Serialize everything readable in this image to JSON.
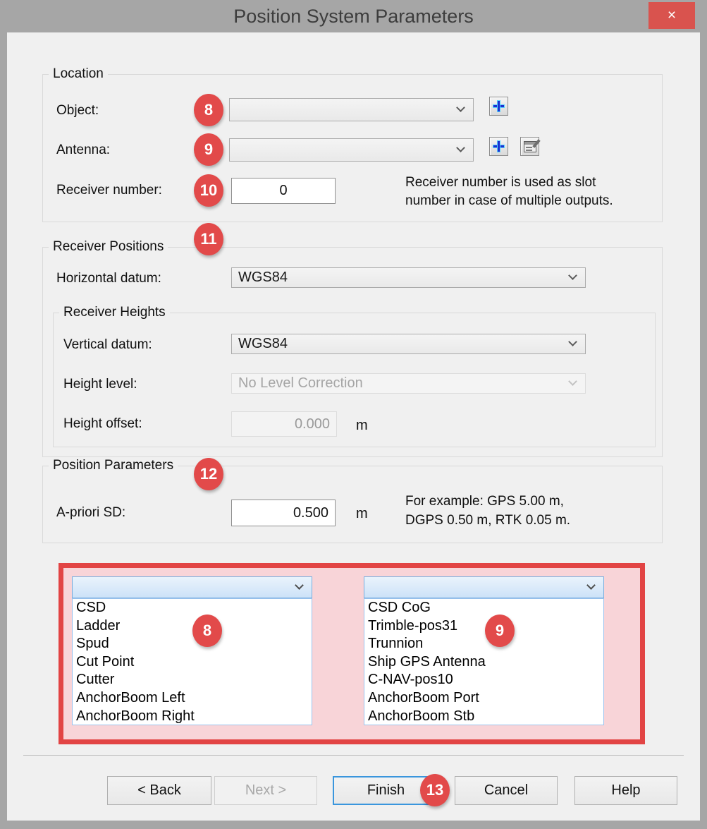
{
  "window": {
    "title": "Position System Parameters",
    "close_glyph": "×"
  },
  "location": {
    "legend": "Location",
    "object_label": "Object:",
    "antenna_label": "Antenna:",
    "receiver_number_label": "Receiver number:",
    "receiver_number_value": "0",
    "hint_line1": "Receiver number is used as slot",
    "hint_line2": "number in case of multiple outputs."
  },
  "receiver_positions": {
    "legend": "Receiver Positions",
    "horizontal_datum_label": "Horizontal datum:",
    "horizontal_datum_value": "WGS84"
  },
  "receiver_heights": {
    "legend": "Receiver Heights",
    "vertical_datum_label": "Vertical datum:",
    "vertical_datum_value": "WGS84",
    "height_level_label": "Height level:",
    "height_level_value": "No Level Correction",
    "height_offset_label": "Height offset:",
    "height_offset_value": "0.000",
    "height_offset_unit": "m"
  },
  "position_parameters": {
    "legend": "Position Parameters",
    "apriori_label": "A-priori SD:",
    "apriori_value": "0.500",
    "apriori_unit": "m",
    "example_line1": "For example: GPS 5.00 m,",
    "example_line2": "DGPS 0.50 m, RTK 0.05 m."
  },
  "lists": {
    "object_list": {
      "items": [
        "CSD",
        "Ladder",
        "Spud",
        "Cut Point",
        "Cutter",
        "AnchorBoom Left",
        "AnchorBoom Right"
      ]
    },
    "antenna_list": {
      "items": [
        "CSD CoG",
        "Trimble-pos31",
        "Trunnion",
        "Ship GPS Antenna",
        "C-NAV-pos10",
        "AnchorBoom Port",
        "AnchorBoom Stb"
      ]
    }
  },
  "badges": {
    "object": "8",
    "antenna": "9",
    "receiver_number": "10",
    "receiver_positions": "11",
    "position_parameters": "12",
    "object_list": "8",
    "antenna_list": "9",
    "finish": "13",
    "color": "#e24a4a"
  },
  "annotation_colors": {
    "box_border": "#e24444",
    "box_fill": "#f8d4d8"
  },
  "buttons": {
    "back": "< Back",
    "next": "Next >",
    "finish": "Finish",
    "cancel": "Cancel",
    "help": "Help"
  }
}
